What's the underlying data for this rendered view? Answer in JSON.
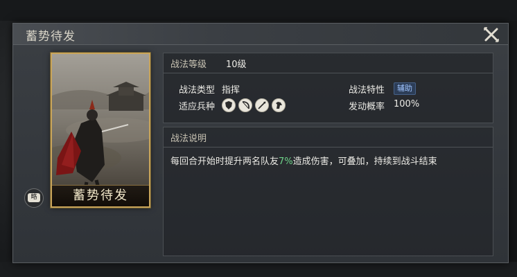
{
  "dialog": {
    "title": "蓄势待发",
    "close_icon": "close-x-icon"
  },
  "card": {
    "name": "蓄势待发",
    "badge": "略"
  },
  "skill": {
    "level_label": "战法等级",
    "level_value": "10级",
    "type_label": "战法类型",
    "type_value": "指挥",
    "trait_label": "战法特性",
    "trait_value": "辅助",
    "troop_label": "适应兵种",
    "troops": [
      "shield-icon",
      "bow-icon",
      "spear-icon",
      "horse-icon"
    ],
    "rate_label": "发动概率",
    "rate_value": "100%"
  },
  "description": {
    "header": "战法说明",
    "text_before": "每回合开始时提升两名队友",
    "highlight": "7%",
    "text_after": "造成伤害，可叠加，持续到战斗结束"
  },
  "colors": {
    "highlight": "#6ed38a",
    "card_border": "#c9a55a",
    "trait_tag": "#9fc4ff"
  }
}
